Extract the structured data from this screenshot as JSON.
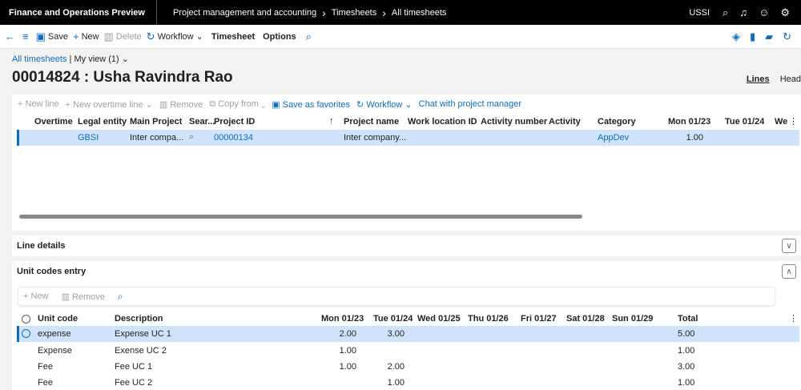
{
  "topbar": {
    "app_title": "Finance and Operations Preview",
    "breadcrumbs": [
      "Project management and accounting",
      "Timesheets",
      "All timesheets"
    ],
    "company": "USSI"
  },
  "actionbar": {
    "save": "Save",
    "new": "New",
    "delete": "Delete",
    "workflow": "Workflow",
    "timesheet": "Timesheet",
    "options": "Options"
  },
  "view": {
    "link": "All timesheets",
    "separator": "|",
    "my_view": "My view (1)"
  },
  "page_title": "00014824 : Usha Ravindra Rao",
  "tabs": [
    "Lines",
    "Head"
  ],
  "lines_toolbar": {
    "new_line": "New line",
    "new_overtime_line": "New overtime line",
    "remove": "Remove",
    "copy_from": "Copy from",
    "save_favorites": "Save as favorites",
    "workflow": "Workflow",
    "chat": "Chat with project manager"
  },
  "lines_grid": {
    "columns": [
      "Overtime",
      "Legal entity",
      "Main Project",
      "Sear...",
      "Project ID",
      "Project name",
      "Work location ID",
      "Activity number",
      "Activity",
      "Category",
      "Mon 01/23",
      "Tue 01/24",
      "We"
    ],
    "rows": [
      {
        "overtime": "",
        "legal_entity": "GBSI",
        "main_project": "Inter compa...",
        "project_id": "00000134",
        "project_name": "Inter company...",
        "work_location": "",
        "activity_number": "",
        "activity": "",
        "category": "AppDev",
        "mon": "1.00",
        "tue": ""
      }
    ]
  },
  "sections": {
    "line_details": "Line details",
    "unit_codes_entry": "Unit codes entry"
  },
  "unit_toolbar": {
    "new": "New",
    "remove": "Remove"
  },
  "unit_grid": {
    "columns": [
      "Unit code",
      "Description",
      "Mon 01/23",
      "Tue 01/24",
      "Wed 01/25",
      "Thu 01/26",
      "Fri 01/27",
      "Sat 01/28",
      "Sun 01/29",
      "Total"
    ],
    "rows": [
      {
        "code": "expense",
        "desc": "Expense UC 1",
        "mon": "2.00",
        "tue": "3.00",
        "total": "5.00"
      },
      {
        "code": "Expense",
        "desc": "Exense UC 2",
        "mon": "1.00",
        "tue": "",
        "total": "1.00"
      },
      {
        "code": "Fee",
        "desc": "Fee UC 1",
        "mon": "1.00",
        "tue": "2.00",
        "total": "3.00"
      },
      {
        "code": "Fee",
        "desc": "Fee UC 2",
        "mon": "",
        "tue": "1.00",
        "total": "1.00"
      }
    ]
  },
  "colors": {
    "accent": "#0f6cbd",
    "selected_row": "#cfe4fa",
    "topbar": "#000000"
  }
}
